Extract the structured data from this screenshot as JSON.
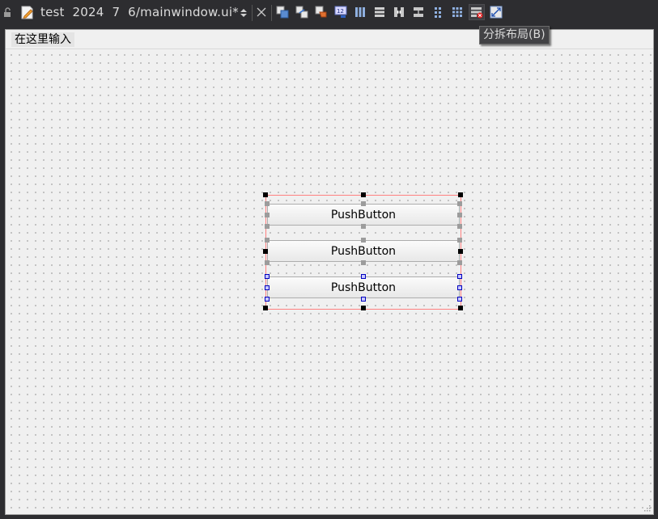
{
  "toolbar": {
    "file_title": "test  2024  7  6/mainwindow.ui*",
    "icons": [
      "lock-icon",
      "file-edit-icon",
      "file-stepper-icon",
      "close-icon",
      "edit-widgets-icon",
      "edit-signals-slots-icon",
      "edit-buddies-icon",
      "edit-tab-order-icon",
      "layout-horizontal-icon",
      "layout-vertical-icon",
      "splitter-horizontal-icon",
      "splitter-vertical-icon",
      "layout-form-icon",
      "layout-grid-icon",
      "break-layout-icon",
      "adjust-size-icon"
    ]
  },
  "tooltip": {
    "text": "分拆布局(B)"
  },
  "form": {
    "menu_placeholder": "在这里输入",
    "buttons": [
      {
        "label": "PushButton"
      },
      {
        "label": "PushButton"
      },
      {
        "label": "PushButton"
      }
    ]
  },
  "colors": {
    "ide_background": "#2d2d30",
    "form_background": "#f0f0f0",
    "layout_border": "#ff8080",
    "selection_handle": "#000000",
    "widget_handle": "#0000c0"
  }
}
